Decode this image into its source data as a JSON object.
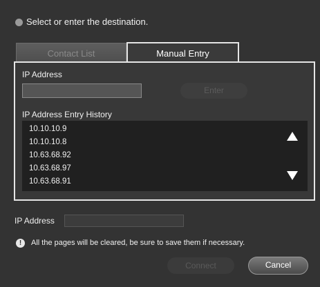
{
  "header": {
    "instruction": "Select or enter the destination."
  },
  "tabs": [
    {
      "label": "Contact List",
      "active": false
    },
    {
      "label": "Manual Entry",
      "active": true
    }
  ],
  "manual_entry": {
    "ip_label": "IP Address",
    "ip_value": "",
    "enter_label": "Enter",
    "history_label": "IP Address Entry History",
    "history": [
      "10.10.10.9",
      "10.10.10.8",
      "10.63.68.92",
      "10.63.68.97",
      "10.63.68.91"
    ]
  },
  "footer": {
    "ip_label": "IP Address",
    "ip_value": "",
    "warning": "All the pages will be cleared, be sure to save them if necessary.",
    "connect_label": "Connect",
    "cancel_label": "Cancel"
  },
  "icons": {
    "up": "arrow-up-icon",
    "down": "arrow-down-icon",
    "warning": "exclamation-icon"
  }
}
